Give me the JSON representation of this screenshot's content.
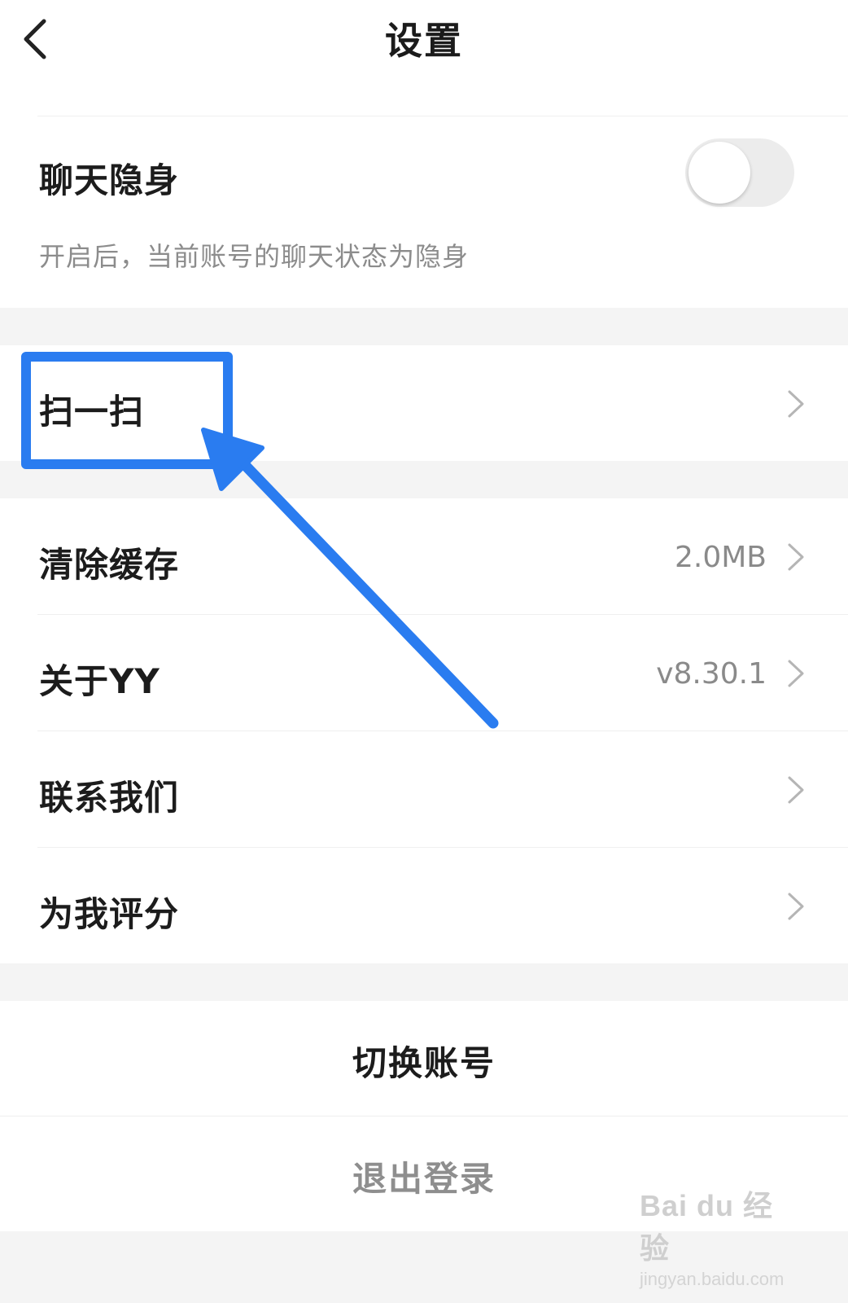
{
  "header": {
    "title": "设置",
    "back_icon": "chevron-left-icon"
  },
  "stealth": {
    "label": "聊天隐身",
    "hint": "开启后，当前账号的聊天状态为隐身",
    "toggle_on": false
  },
  "scan": {
    "label": "扫一扫"
  },
  "menu": {
    "clear_cache_label": "清除缓存",
    "clear_cache_value": "2.0MB",
    "about_label": "关于YY",
    "about_value": "v8.30.1",
    "contact_label": "联系我们",
    "rate_label": "为我评分"
  },
  "account": {
    "switch_label": "切换账号",
    "logout_label": "退出登录"
  },
  "annotation": {
    "color": "#2a7cf0"
  },
  "watermark": {
    "logo": "Bai du 经验",
    "url": "jingyan.baidu.com"
  },
  "colors": {
    "text_primary": "#1c1c1c",
    "text_secondary": "#8a8a8a",
    "logout_text": "#8e8e8e",
    "section_gap": "#f4f4f4"
  }
}
